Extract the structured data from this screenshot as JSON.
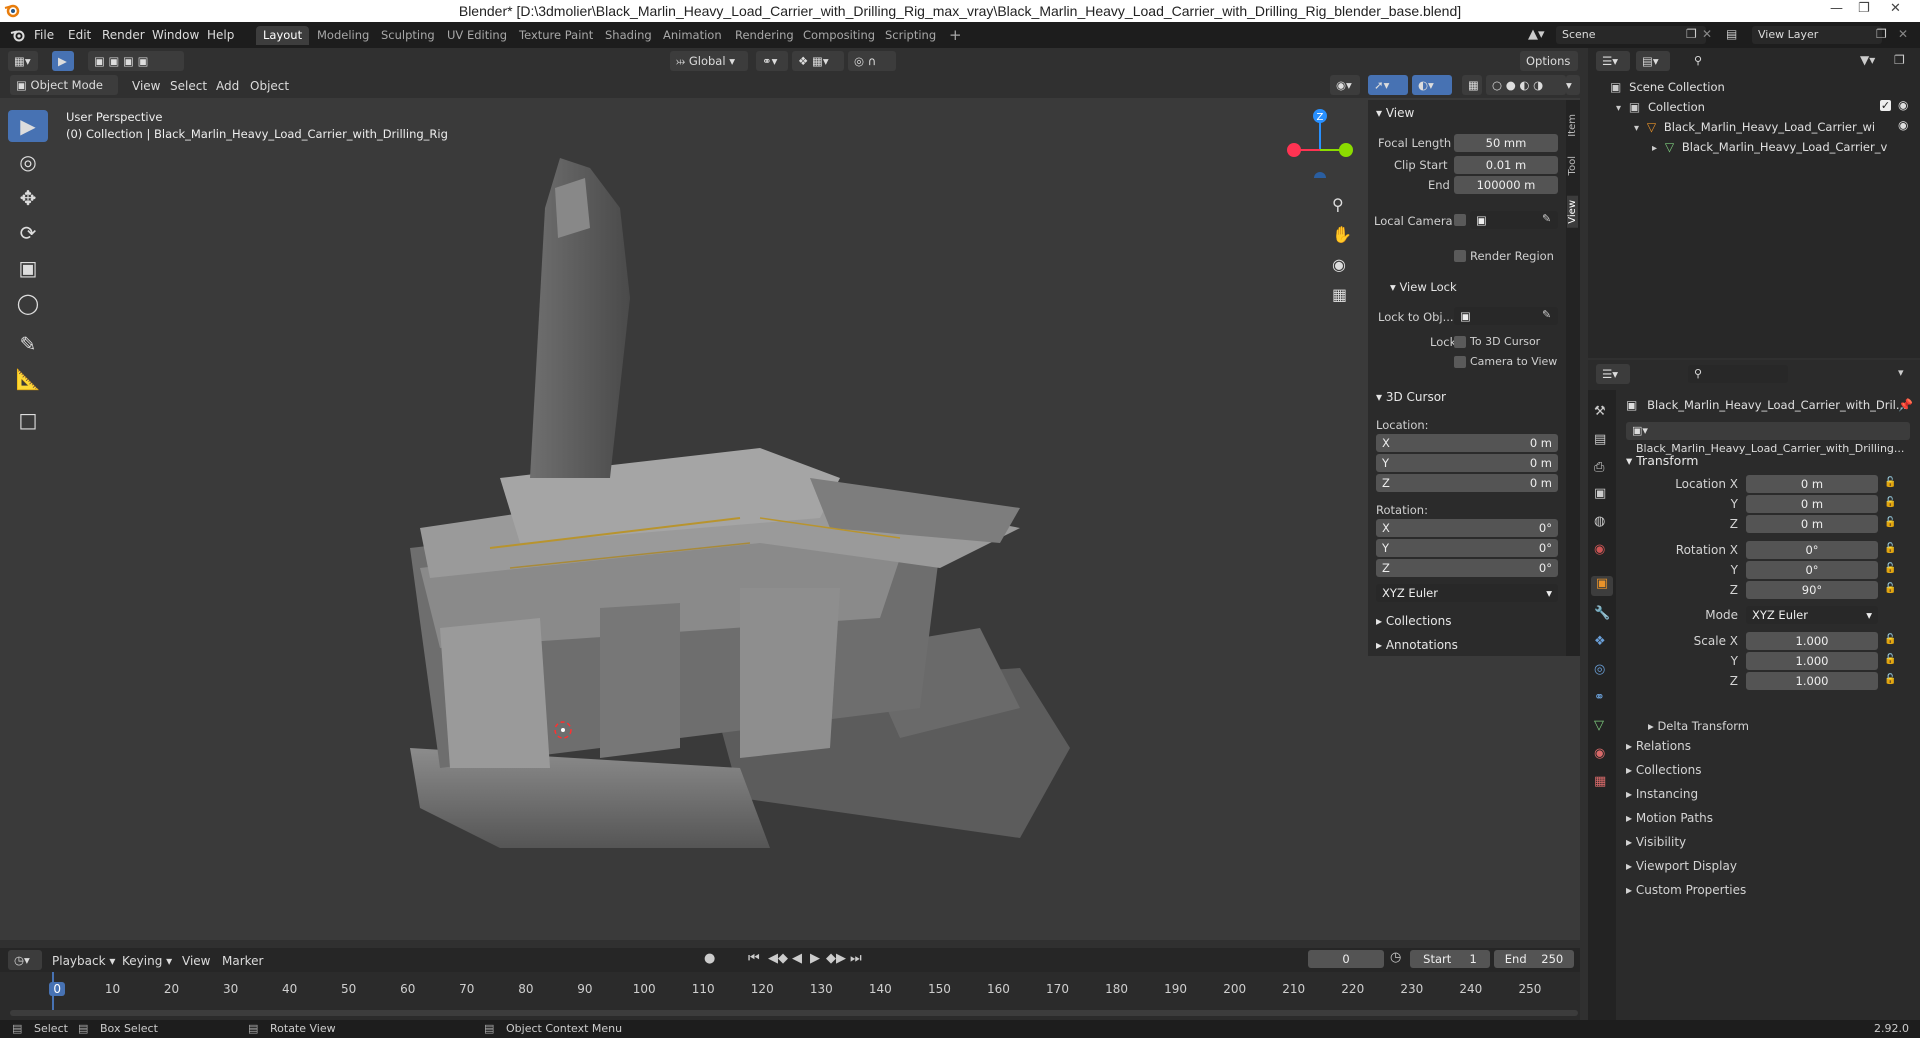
{
  "window": {
    "title": "Blender* [D:\\3dmolier\\Black_Marlin_Heavy_Load_Carrier_with_Drilling_Rig_max_vray\\Black_Marlin_Heavy_Load_Carrier_with_Drilling_Rig_blender_base.blend]"
  },
  "menu": [
    "File",
    "Edit",
    "Render",
    "Window",
    "Help"
  ],
  "workspaces": [
    "Layout",
    "Modeling",
    "Sculpting",
    "UV Editing",
    "Texture Paint",
    "Shading",
    "Animation",
    "Rendering",
    "Compositing",
    "Scripting"
  ],
  "active_workspace": "Layout",
  "scene": {
    "name": "Scene",
    "view_layer": "View Layer"
  },
  "viewport": {
    "mode": "Object Mode",
    "header_menus": [
      "View",
      "Select",
      "Add",
      "Object"
    ],
    "orientation": "Global",
    "options_label": "Options",
    "overlay_title": "User Perspective",
    "overlay_subtitle": "(0) Collection | Black_Marlin_Heavy_Load_Carrier_with_Drilling_Rig",
    "gizmo_axis_label": "Z"
  },
  "npanel": {
    "tabs": [
      "Item",
      "Tool",
      "View"
    ],
    "view": {
      "header": "View",
      "focal_length_label": "Focal Length",
      "focal_length": "50 mm",
      "clip_start_label": "Clip Start",
      "clip_start": "0.01 m",
      "end_label": "End",
      "end": "100000 m",
      "local_camera_label": "Local Camera",
      "render_region_label": "Render Region",
      "view_lock_header": "View Lock",
      "lock_to_obj_label": "Lock to Obj...",
      "lock_label": "Lock",
      "to_3d_cursor_label": "To 3D Cursor",
      "camera_to_view_label": "Camera to View"
    },
    "cursor": {
      "header": "3D Cursor",
      "location_label": "Location:",
      "x_label": "X",
      "x": "0 m",
      "y_label": "Y",
      "y": "0 m",
      "z_label": "Z",
      "z": "0 m",
      "rotation_label": "Rotation:",
      "rx_label": "X",
      "rx": "0°",
      "ry_label": "Y",
      "ry": "0°",
      "rz_label": "Z",
      "rz": "0°",
      "rotation_mode": "XYZ Euler"
    },
    "collections_label": "Collections",
    "annotations_label": "Annotations"
  },
  "outliner": {
    "scene_collection": "Scene Collection",
    "collection": "Collection",
    "object": "Black_Marlin_Heavy_Load_Carrier_with_",
    "mesh": "Black_Marlin_Heavy_Load_Carrier_v"
  },
  "properties": {
    "object_name": "Black_Marlin_Heavy_Load_Carrier_with_Dril...",
    "object_data_name": "Black_Marlin_Heavy_Load_Carrier_with_Drilling...",
    "transform_header": "Transform",
    "location_x_label": "Location X",
    "location_x": "0 m",
    "location_y_label": "Y",
    "location_y": "0 m",
    "location_z_label": "Z",
    "location_z": "0 m",
    "rotation_x_label": "Rotation X",
    "rotation_x": "0°",
    "rotation_y_label": "Y",
    "rotation_y": "0°",
    "rotation_z_label": "Z",
    "rotation_z": "90°",
    "mode_label": "Mode",
    "mode": "XYZ Euler",
    "scale_x_label": "Scale X",
    "scale_x": "1.000",
    "scale_y_label": "Y",
    "scale_y": "1.000",
    "scale_z_label": "Z",
    "scale_z": "1.000",
    "delta_transform": "Delta Transform",
    "sections": [
      "Relations",
      "Collections",
      "Instancing",
      "Motion Paths",
      "Visibility",
      "Viewport Display",
      "Custom Properties"
    ]
  },
  "timeline": {
    "menus": [
      "Playback",
      "Keying",
      "View",
      "Marker"
    ],
    "current_frame": "0",
    "start_label": "Start",
    "start": "1",
    "end_label": "End",
    "end": "250",
    "ticks": [
      "0",
      "10",
      "20",
      "30",
      "40",
      "50",
      "60",
      "70",
      "80",
      "90",
      "100",
      "110",
      "120",
      "130",
      "140",
      "150",
      "160",
      "170",
      "180",
      "190",
      "200",
      "210",
      "220",
      "230",
      "240",
      "250"
    ]
  },
  "statusbar": {
    "select": "Select",
    "box_select": "Box Select",
    "rotate_view": "Rotate View",
    "context_menu": "Object Context Menu",
    "version": "2.92.0"
  },
  "colors": {
    "accent": "#4772b3",
    "axis_x": "#ff3352",
    "axis_y": "#8bdc00",
    "axis_z": "#2890ff",
    "background": "#303030",
    "panel": "#2b2b2b"
  }
}
